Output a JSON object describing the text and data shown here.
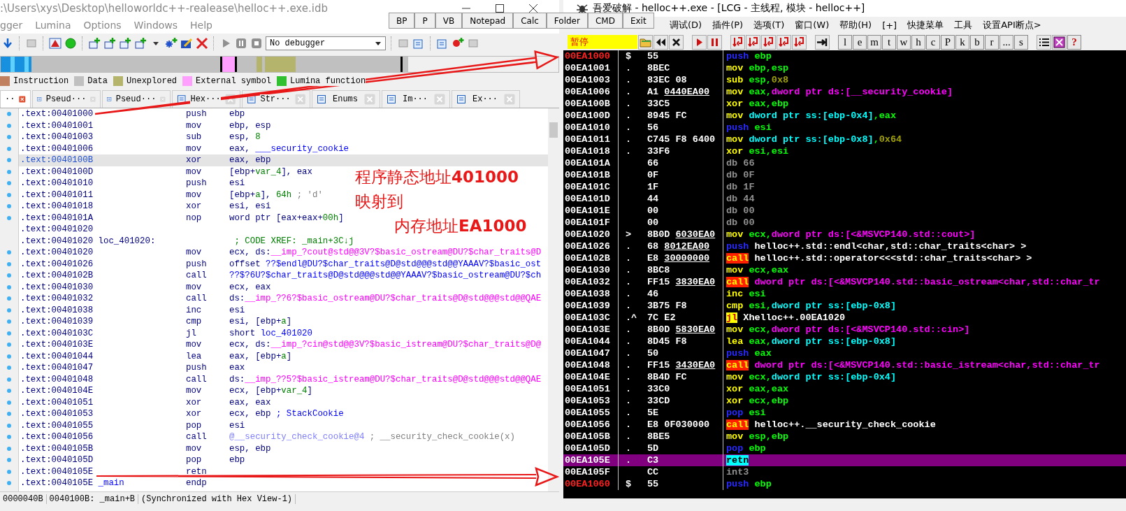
{
  "ida": {
    "title": ":\\Users\\xys\\Desktop\\helloworldc++-realease\\helloc++.exe.idb",
    "menu": [
      "gger",
      "Lumina",
      "Options",
      "Windows",
      "Help"
    ],
    "debugger_select": "No debugger",
    "legend": [
      {
        "label": "Instruction",
        "color": "#c08060"
      },
      {
        "label": "Data",
        "color": "#c0c0c0"
      },
      {
        "label": "Unexplored",
        "color": "#b4b46c"
      },
      {
        "label": "External symbol",
        "color": "#ffa0ff"
      },
      {
        "label": "Lumina function",
        "color": "#30c030"
      }
    ],
    "tabs": [
      {
        "label": "··",
        "selected": true
      },
      {
        "label": "Pseud···",
        "selected": false
      },
      {
        "label": "Pseud···",
        "selected": false
      },
      {
        "label": "Hex···",
        "selected": false
      },
      {
        "label": "Str···",
        "selected": false
      },
      {
        "label": "Enums",
        "selected": false
      },
      {
        "label": "Im···",
        "selected": false
      },
      {
        "label": "Ex···",
        "selected": false
      }
    ],
    "rows": [
      {
        "addr": ".text:00401000",
        "mn": "push",
        "ops": [
          {
            "t": "ebp",
            "kind": "p"
          }
        ],
        "selected": false
      },
      {
        "addr": ".text:00401001",
        "mn": "mov",
        "ops": [
          {
            "t": "ebp, esp",
            "kind": "p"
          }
        ],
        "selected": false
      },
      {
        "addr": ".text:00401003",
        "mn": "sub",
        "ops": [
          {
            "t": "esp, ",
            "kind": "p"
          },
          {
            "t": "8",
            "kind": "num"
          }
        ],
        "selected": false
      },
      {
        "addr": ".text:00401006",
        "mn": "mov",
        "ops": [
          {
            "t": "eax, ",
            "kind": "p"
          },
          {
            "t": "___security_cookie",
            "kind": "n"
          }
        ],
        "selected": false
      },
      {
        "addr": ".text:0040100B",
        "mn": "xor",
        "ops": [
          {
            "t": "eax, ebp",
            "kind": "p"
          }
        ],
        "selected": true
      },
      {
        "addr": ".text:0040100D",
        "mn": "mov",
        "ops": [
          {
            "t": "[ebp+",
            "kind": "p"
          },
          {
            "t": "var_4",
            "kind": "v"
          },
          {
            "t": "], eax",
            "kind": "p"
          }
        ],
        "selected": false
      },
      {
        "addr": ".text:00401010",
        "mn": "push",
        "ops": [
          {
            "t": "esi",
            "kind": "p"
          }
        ],
        "selected": false
      },
      {
        "addr": ".text:00401011",
        "mn": "mov",
        "ops": [
          {
            "t": "[ebp+",
            "kind": "p"
          },
          {
            "t": "a",
            "kind": "v"
          },
          {
            "t": "], ",
            "kind": "p"
          },
          {
            "t": "64h",
            "kind": "num"
          }
        ],
        "comment": {
          "t": "; 'd'",
          "kind": "c"
        },
        "selected": false
      },
      {
        "addr": ".text:00401018",
        "mn": "xor",
        "ops": [
          {
            "t": "esi, esi",
            "kind": "p"
          }
        ],
        "selected": false
      },
      {
        "addr": ".text:0040101A",
        "mn": "nop",
        "ops": [
          {
            "t": "word ptr [eax+eax+",
            "kind": "p"
          },
          {
            "t": "00h",
            "kind": "num"
          },
          {
            "t": "]",
            "kind": "p"
          }
        ],
        "selected": false
      },
      {
        "addr": ".text:00401020",
        "selected": false
      },
      {
        "addr": ".text:00401020",
        "label": {
          "t": "loc_401020:",
          "kind": "p"
        },
        "comment": {
          "t": "; CODE XREF: _main+3C↓j",
          "kind": "x"
        },
        "selected": false
      },
      {
        "addr": ".text:00401020",
        "mn": "mov",
        "ops": [
          {
            "t": "ecx, ds:",
            "kind": "p"
          },
          {
            "t": "__imp_?cout@std@@3V?$basic_ostream@DU?$char_traits@D",
            "kind": "i"
          }
        ],
        "selected": false
      },
      {
        "addr": ".text:00401026",
        "mn": "push",
        "ops": [
          {
            "t": "offset ",
            "kind": "p"
          },
          {
            "t": "??$endl@DU?$char_traits@D@std@@@std@@YAAAV?$basic_ost",
            "kind": "n"
          }
        ],
        "selected": false
      },
      {
        "addr": ".text:0040102B",
        "mn": "call",
        "ops": [
          {
            "t": "??$?6U?$char_traits@D@std@@@std@@YAAAV?$basic_ostream@DU?$ch",
            "kind": "n"
          }
        ],
        "selected": false
      },
      {
        "addr": ".text:00401030",
        "mn": "mov",
        "ops": [
          {
            "t": "ecx, eax",
            "kind": "p"
          }
        ],
        "selected": false
      },
      {
        "addr": ".text:00401032",
        "mn": "call",
        "ops": [
          {
            "t": "ds:",
            "kind": "p"
          },
          {
            "t": "__imp_??6?$basic_ostream@DU?$char_traits@D@std@@@std@@QAE",
            "kind": "i"
          }
        ],
        "selected": false
      },
      {
        "addr": ".text:00401038",
        "mn": "inc",
        "ops": [
          {
            "t": "esi",
            "kind": "p"
          }
        ],
        "selected": false
      },
      {
        "addr": ".text:00401039",
        "mn": "cmp",
        "ops": [
          {
            "t": "esi, [ebp+",
            "kind": "p"
          },
          {
            "t": "a",
            "kind": "v"
          },
          {
            "t": "]",
            "kind": "p"
          }
        ],
        "selected": false
      },
      {
        "addr": ".text:0040103C",
        "mn": "jl",
        "ops": [
          {
            "t": "short ",
            "kind": "p"
          },
          {
            "t": "loc_401020",
            "kind": "n"
          }
        ],
        "selected": false
      },
      {
        "addr": ".text:0040103E",
        "mn": "mov",
        "ops": [
          {
            "t": "ecx, ds:",
            "kind": "p"
          },
          {
            "t": "__imp_?cin@std@@3V?$basic_istream@DU?$char_traits@D@",
            "kind": "i"
          }
        ],
        "selected": false
      },
      {
        "addr": ".text:00401044",
        "mn": "lea",
        "ops": [
          {
            "t": "eax, [ebp+",
            "kind": "p"
          },
          {
            "t": "a",
            "kind": "v"
          },
          {
            "t": "]",
            "kind": "p"
          }
        ],
        "selected": false
      },
      {
        "addr": ".text:00401047",
        "mn": "push",
        "ops": [
          {
            "t": "eax",
            "kind": "p"
          }
        ],
        "selected": false
      },
      {
        "addr": ".text:00401048",
        "mn": "call",
        "ops": [
          {
            "t": "ds:",
            "kind": "p"
          },
          {
            "t": "__imp_??5?$basic_istream@DU?$char_traits@D@std@@@std@@QAE",
            "kind": "i"
          }
        ],
        "selected": false
      },
      {
        "addr": ".text:0040104E",
        "mn": "mov",
        "ops": [
          {
            "t": "ecx, [ebp+",
            "kind": "p"
          },
          {
            "t": "var_4",
            "kind": "v"
          },
          {
            "t": "]",
            "kind": "p"
          }
        ],
        "selected": false
      },
      {
        "addr": ".text:00401051",
        "mn": "xor",
        "ops": [
          {
            "t": "eax, eax",
            "kind": "p"
          }
        ],
        "selected": false
      },
      {
        "addr": ".text:00401053",
        "mn": "xor",
        "ops": [
          {
            "t": "ecx, ebp",
            "kind": "p"
          }
        ],
        "comment": {
          "t": "; StackCookie",
          "kind": "s"
        },
        "selected": false
      },
      {
        "addr": ".text:00401055",
        "mn": "pop",
        "ops": [
          {
            "t": "esi",
            "kind": "p"
          }
        ],
        "selected": false
      },
      {
        "addr": ".text:00401056",
        "mn": "call",
        "ops": [
          {
            "t": "@__security_check_cookie@4",
            "kind": "f"
          }
        ],
        "comment": {
          "t": "; __security_check_cookie(x)",
          "kind": "c"
        },
        "selected": false
      },
      {
        "addr": ".text:0040105B",
        "mn": "mov",
        "ops": [
          {
            "t": "esp, ebp",
            "kind": "p"
          }
        ],
        "selected": false
      },
      {
        "addr": ".text:0040105D",
        "mn": "pop",
        "ops": [
          {
            "t": "ebp",
            "kind": "p"
          }
        ],
        "selected": false
      },
      {
        "addr": ".text:0040105E",
        "mn": "retn",
        "selected": false
      },
      {
        "addr": ".text:0040105E",
        "label": {
          "t": "_main",
          "kind": "n"
        },
        "mn": "endp",
        "selected": false
      }
    ],
    "status": [
      "0000040B",
      "0040100B: _main+B",
      "(Synchronized with Hex View-1)"
    ]
  },
  "quick_buttons": [
    "BP",
    "P",
    "VB",
    "Notepad",
    "Calc",
    "Folder",
    "CMD",
    "Exit"
  ],
  "annotation": [
    "程序静态地址**401000**",
    "映射到",
    "内存地址**EA1000**"
  ],
  "olly": {
    "title": "吾爱破解 - helloc++.exe - [LCG - 主线程, 模块 - helloc++]",
    "menu": [
      "调试(D)",
      "插件(P)",
      "选项(T)",
      "窗口(W)",
      "帮助(H)",
      "[+]",
      "快捷菜单",
      "工具",
      "设置API断点>"
    ],
    "state": "暂停",
    "letter_buttons": [
      "l",
      "e",
      "m",
      "t",
      "w",
      "h",
      "c",
      "P",
      "k",
      "b",
      "r",
      "...",
      "s"
    ],
    "help_button": "?",
    "rows": [
      {
        "addr": "00EA1000",
        "marked": true,
        "mk": "$",
        "hex": "55",
        "op": {
          "t": "push",
          "kind": "op_push"
        },
        "args": [
          {
            "t": "ebp",
            "kind": "reg"
          }
        ],
        "selected": false
      },
      {
        "addr": "00EA1001",
        "marked": false,
        "mk": ".",
        "hex": "8BEC",
        "op": {
          "t": "mov",
          "kind": "op"
        },
        "args": [
          {
            "t": "ebp,esp",
            "kind": "reg"
          }
        ],
        "selected": false
      },
      {
        "addr": "00EA1003",
        "marked": false,
        "mk": ".",
        "hex": "83EC 08",
        "op": {
          "t": "sub",
          "kind": "op"
        },
        "args": [
          {
            "t": "esp,",
            "kind": "reg"
          },
          {
            "t": "0x8",
            "kind": "num"
          }
        ],
        "selected": false
      },
      {
        "addr": "00EA1006",
        "marked": false,
        "mk": ".",
        "hex": "A1",
        "ref": "0440EA00",
        "op": {
          "t": "mov",
          "kind": "op"
        },
        "args": [
          {
            "t": "eax,",
            "kind": "reg"
          },
          {
            "t": "dword ptr ds:[__security_cookie]",
            "kind": "imp"
          }
        ],
        "selected": false
      },
      {
        "addr": "00EA100B",
        "marked": false,
        "mk": ".",
        "hex": "33C5",
        "op": {
          "t": "xor",
          "kind": "op"
        },
        "args": [
          {
            "t": "eax,ebp",
            "kind": "reg"
          }
        ],
        "selected": false
      },
      {
        "addr": "00EA100D",
        "marked": false,
        "mk": ".",
        "hex": "8945 FC",
        "op": {
          "t": "mov",
          "kind": "op"
        },
        "args": [
          {
            "t": "dword ptr ss:[ebp-0x4]",
            "kind": "mem"
          },
          {
            "t": ",eax",
            "kind": "reg"
          }
        ],
        "selected": false
      },
      {
        "addr": "00EA1010",
        "marked": false,
        "mk": ".",
        "hex": "56",
        "op": {
          "t": "push",
          "kind": "op_push"
        },
        "args": [
          {
            "t": "esi",
            "kind": "reg"
          }
        ],
        "selected": false
      },
      {
        "addr": "00EA1011",
        "marked": false,
        "mk": ".",
        "hex": "C745 F8 6400",
        "op": {
          "t": "mov",
          "kind": "op"
        },
        "args": [
          {
            "t": "dword ptr ss:[ebp-0x8]",
            "kind": "mem"
          },
          {
            "t": ",",
            "kind": "reg"
          },
          {
            "t": "0x64",
            "kind": "num"
          }
        ],
        "selected": false
      },
      {
        "addr": "00EA1018",
        "marked": false,
        "mk": ".",
        "hex": "33F6",
        "op": {
          "t": "xor",
          "kind": "op"
        },
        "args": [
          {
            "t": "esi,esi",
            "kind": "reg"
          }
        ],
        "selected": false
      },
      {
        "addr": "00EA101A",
        "marked": false,
        "hex": "66",
        "op": {
          "t": "db",
          "kind": "op_db"
        },
        "args": [
          {
            "t": "66",
            "kind": "db"
          }
        ],
        "selected": false
      },
      {
        "addr": "00EA101B",
        "marked": false,
        "hex": "0F",
        "op": {
          "t": "db",
          "kind": "op_db"
        },
        "args": [
          {
            "t": "0F",
            "kind": "db"
          }
        ],
        "selected": false
      },
      {
        "addr": "00EA101C",
        "marked": false,
        "hex": "1F",
        "op": {
          "t": "db",
          "kind": "op_db"
        },
        "args": [
          {
            "t": "1F",
            "kind": "db"
          }
        ],
        "selected": false
      },
      {
        "addr": "00EA101D",
        "marked": false,
        "hex": "44",
        "op": {
          "t": "db",
          "kind": "op_db"
        },
        "args": [
          {
            "t": "44",
            "kind": "db"
          }
        ],
        "selected": false
      },
      {
        "addr": "00EA101E",
        "marked": false,
        "hex": "00",
        "op": {
          "t": "db",
          "kind": "op_db"
        },
        "args": [
          {
            "t": "00",
            "kind": "db"
          }
        ],
        "selected": false
      },
      {
        "addr": "00EA101F",
        "marked": false,
        "hex": "00",
        "op": {
          "t": "db",
          "kind": "op_db"
        },
        "args": [
          {
            "t": "00",
            "kind": "db"
          }
        ],
        "selected": false
      },
      {
        "addr": "00EA1020",
        "marked": false,
        "mk": ">",
        "hex": "8B0D",
        "ref": "6030EA0",
        "op": {
          "t": "mov",
          "kind": "op"
        },
        "args": [
          {
            "t": "ecx,",
            "kind": "reg"
          },
          {
            "t": "dword ptr ds:[<&MSVCP140.std::cout>]",
            "kind": "imp"
          }
        ],
        "selected": false
      },
      {
        "addr": "00EA1026",
        "marked": false,
        "mk": ".",
        "hex": "68",
        "ref": "8012EA00",
        "op": {
          "t": "push",
          "kind": "op_push"
        },
        "args": [
          {
            "t": "helloc++.std::endl<char,std::char_traits<char> >",
            "kind": "sym"
          }
        ],
        "selected": false
      },
      {
        "addr": "00EA102B",
        "marked": false,
        "mk": ".",
        "hex": "E8",
        "ref": "30000000",
        "op": {
          "t": "call",
          "kind": "op_call"
        },
        "args": [
          {
            "t": "helloc++.std::operator<<<std::char_traits<char> >",
            "kind": "sym"
          }
        ],
        "selected": false
      },
      {
        "addr": "00EA1030",
        "marked": false,
        "mk": ".",
        "hex": "8BC8",
        "op": {
          "t": "mov",
          "kind": "op"
        },
        "args": [
          {
            "t": "ecx,eax",
            "kind": "reg"
          }
        ],
        "selected": false
      },
      {
        "addr": "00EA1032",
        "marked": false,
        "mk": ".",
        "hex": "FF15",
        "ref": "3830EA0",
        "op": {
          "t": "call",
          "kind": "op_call"
        },
        "args": [
          {
            "t": "dword ptr ds:[<&MSVCP140.std::basic_ostream<char,std::char_tr",
            "kind": "imp"
          }
        ],
        "selected": false
      },
      {
        "addr": "00EA1038",
        "marked": false,
        "mk": ".",
        "hex": "46",
        "op": {
          "t": "inc",
          "kind": "op"
        },
        "args": [
          {
            "t": "esi",
            "kind": "reg"
          }
        ],
        "selected": false
      },
      {
        "addr": "00EA1039",
        "marked": false,
        "mk": ".",
        "hex": "3B75 F8",
        "op": {
          "t": "cmp",
          "kind": "op"
        },
        "args": [
          {
            "t": "esi,",
            "kind": "reg"
          },
          {
            "t": "dword ptr ss:[ebp-0x8]",
            "kind": "mem"
          }
        ],
        "selected": false
      },
      {
        "addr": "00EA103C",
        "marked": false,
        "mk": ".^",
        "hex": "7C E2",
        "op": {
          "t": "jl",
          "kind": "op_jump"
        },
        "args": [
          {
            "t": "Xhelloc++.00EA1020",
            "kind": "sym"
          }
        ],
        "selected": false
      },
      {
        "addr": "00EA103E",
        "marked": false,
        "mk": ".",
        "hex": "8B0D",
        "ref": "5830EA0",
        "op": {
          "t": "mov",
          "kind": "op"
        },
        "args": [
          {
            "t": "ecx,",
            "kind": "reg"
          },
          {
            "t": "dword ptr ds:[<&MSVCP140.std::cin>]",
            "kind": "imp"
          }
        ],
        "selected": false
      },
      {
        "addr": "00EA1044",
        "marked": false,
        "mk": ".",
        "hex": "8D45 F8",
        "op": {
          "t": "lea",
          "kind": "op"
        },
        "args": [
          {
            "t": "eax,",
            "kind": "reg"
          },
          {
            "t": "dword ptr ss:[ebp-0x8]",
            "kind": "mem"
          }
        ],
        "selected": false
      },
      {
        "addr": "00EA1047",
        "marked": false,
        "mk": ".",
        "hex": "50",
        "op": {
          "t": "push",
          "kind": "op_push"
        },
        "args": [
          {
            "t": "eax",
            "kind": "reg"
          }
        ],
        "selected": false
      },
      {
        "addr": "00EA1048",
        "marked": false,
        "mk": ".",
        "hex": "FF15",
        "ref": "3430EA0",
        "op": {
          "t": "call",
          "kind": "op_call"
        },
        "args": [
          {
            "t": "dword ptr ds:[<&MSVCP140.std::basic_istream<char,std::char_tr",
            "kind": "imp"
          }
        ],
        "selected": false
      },
      {
        "addr": "00EA104E",
        "marked": false,
        "mk": ".",
        "hex": "8B4D FC",
        "op": {
          "t": "mov",
          "kind": "op"
        },
        "args": [
          {
            "t": "ecx,",
            "kind": "reg"
          },
          {
            "t": "dword ptr ss:[ebp-0x4]",
            "kind": "mem"
          }
        ],
        "selected": false
      },
      {
        "addr": "00EA1051",
        "marked": false,
        "mk": ".",
        "hex": "33C0",
        "op": {
          "t": "xor",
          "kind": "op"
        },
        "args": [
          {
            "t": "eax,eax",
            "kind": "reg"
          }
        ],
        "selected": false
      },
      {
        "addr": "00EA1053",
        "marked": false,
        "mk": ".",
        "hex": "33CD",
        "op": {
          "t": "xor",
          "kind": "op"
        },
        "args": [
          {
            "t": "ecx,ebp",
            "kind": "reg"
          }
        ],
        "selected": false
      },
      {
        "addr": "00EA1055",
        "marked": false,
        "mk": ".",
        "hex": "5E",
        "op": {
          "t": "pop",
          "kind": "op_push"
        },
        "args": [
          {
            "t": "esi",
            "kind": "reg"
          }
        ],
        "selected": false
      },
      {
        "addr": "00EA1056",
        "marked": false,
        "mk": ".",
        "hex": "E8 0F030000",
        "op": {
          "t": "call",
          "kind": "op_call"
        },
        "args": [
          {
            "t": "helloc++.__security_check_cookie",
            "kind": "sym"
          }
        ],
        "selected": false
      },
      {
        "addr": "00EA105B",
        "marked": false,
        "mk": ".",
        "hex": "8BE5",
        "op": {
          "t": "mov",
          "kind": "op"
        },
        "args": [
          {
            "t": "esp,ebp",
            "kind": "reg"
          }
        ],
        "selected": false
      },
      {
        "addr": "00EA105D",
        "marked": false,
        "mk": ".",
        "hex": "5D",
        "op": {
          "t": "pop",
          "kind": "op_push"
        },
        "args": [
          {
            "t": "ebp",
            "kind": "reg"
          }
        ],
        "selected": false
      },
      {
        "addr": "00EA105E",
        "marked": false,
        "mk": ".",
        "hex": "C3",
        "op": {
          "t": "retn",
          "kind": "op_ret"
        },
        "selected": true
      },
      {
        "addr": "00EA105F",
        "marked": false,
        "hex": "CC",
        "op": {
          "t": "int3",
          "kind": "op_db"
        },
        "selected": false
      },
      {
        "addr": "00EA1060",
        "marked": true,
        "mk": "$",
        "hex": "55",
        "op": {
          "t": "push",
          "kind": "op_push"
        },
        "args": [
          {
            "t": "ebp",
            "kind": "reg"
          }
        ],
        "selected": false
      }
    ]
  }
}
